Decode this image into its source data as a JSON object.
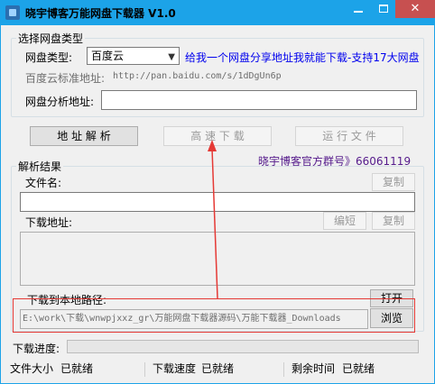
{
  "window": {
    "title": "晓宇博客万能网盘下载器 V1.0",
    "close_glyph": "✕"
  },
  "netdisk_group": {
    "title": "选择网盘类型",
    "type_label": "网盘类型:",
    "type_selected": "百度云",
    "promo_link": "给我一个网盘分享地址我就能下载-支持17大网盘",
    "standard_addr_label": "百度云标准地址:",
    "standard_addr_value": "http://pan.baidu.com/s/1dDgUn6p",
    "analyze_addr_label": "网盘分析地址:",
    "analyze_addr_value": ""
  },
  "actions": {
    "parse_button": "地 址 解 析",
    "fast_download_button": "高 速 下 载",
    "run_file_button": "运 行 文 件",
    "qq_group_link": "晓宇博客官方群号》66061119"
  },
  "result_group": {
    "title": "解析结果",
    "filename_label": "文件名:",
    "copy_button": "复制",
    "filename_value": "",
    "download_addr_label": "下载地址:",
    "shorten_button": "编短",
    "copy_button_2": "复制",
    "download_addr_value": ""
  },
  "local_path": {
    "label": "下载到本地路径:",
    "open_button": "打开",
    "path_value": "E:\\work\\下载\\wnwpjxxz_gr\\万能网盘下载器源码\\万能下载器_Downloads",
    "browse_button": "浏览"
  },
  "progress": {
    "label": "下载进度:",
    "value": 0
  },
  "status": {
    "size_label": "文件大小",
    "size_value": "已就绪",
    "speed_label": "下载速度",
    "speed_value": "已就绪",
    "remaining_label": "剩余时间",
    "remaining_value": "已就绪"
  },
  "colors": {
    "titlebar": "#1CA3E8",
    "close": "#C75050",
    "highlight": "#E53935",
    "link": "#0000EE",
    "link_visited": "#551A8B"
  }
}
